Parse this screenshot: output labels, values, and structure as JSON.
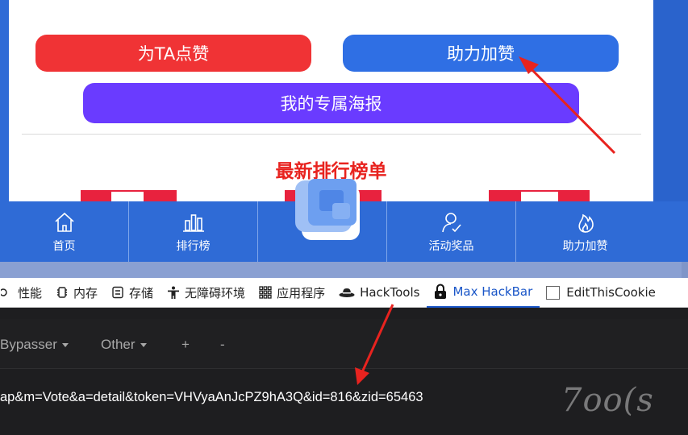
{
  "page": {
    "buttons": {
      "like": "为TA点赞",
      "boost": "助力加赞",
      "poster": "我的专属海报"
    },
    "ranking_title": "最新排行榜单"
  },
  "tabbar": {
    "items": [
      {
        "label": "首页",
        "icon": "home-icon"
      },
      {
        "label": "排行榜",
        "icon": "bar-chart-icon"
      },
      {
        "label": "活动奖品",
        "icon": "user-check-icon"
      },
      {
        "label": "助力加赞",
        "icon": "flame-icon"
      }
    ]
  },
  "devtools": {
    "tabs": [
      {
        "label": "性能",
        "icon": "performance-icon"
      },
      {
        "label": "内存",
        "icon": "memory-icon"
      },
      {
        "label": "存储",
        "icon": "storage-icon"
      },
      {
        "label": "无障碍环境",
        "icon": "accessibility-icon"
      },
      {
        "label": "应用程序",
        "icon": "grid-icon"
      },
      {
        "label": "HackTools",
        "icon": "hat-icon"
      },
      {
        "label": "Max HackBar",
        "icon": "lock-icon",
        "active": true
      },
      {
        "label": "EditThisCookie",
        "icon": "checkbox-icon"
      }
    ]
  },
  "hackbar": {
    "menus": [
      "Bypasser",
      "Other",
      "+",
      "-"
    ],
    "url": "ap&m=Vote&a=detail&token=VHVyaAnJcPZ9hA3Q&id=816&zid=65463"
  },
  "watermark": "7oo(s",
  "colors": {
    "like": "#f03335",
    "boost": "#2f6fe4",
    "poster": "#6a3bff",
    "tabbar": "#2f6bd6",
    "ranking_title": "#e8231f",
    "annotation_arrow": "#e8231f"
  }
}
